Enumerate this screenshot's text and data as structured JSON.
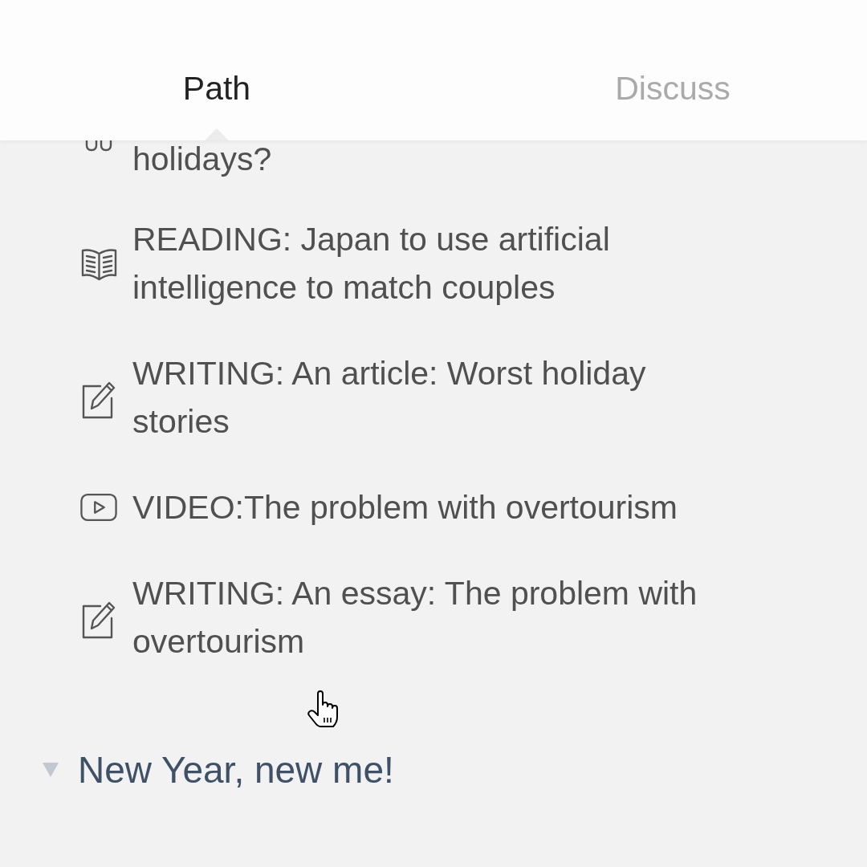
{
  "tabs": [
    {
      "label": "Path",
      "selected": true
    },
    {
      "label": "Discuss",
      "selected": false
    }
  ],
  "items": [
    {
      "kind": "cut",
      "title": "holidays?"
    },
    {
      "kind": "reading",
      "title": "READING: Japan to use artificial intelligence to match couples"
    },
    {
      "kind": "writing",
      "title": "WRITING: An article: Worst holiday stories"
    },
    {
      "kind": "video",
      "title": "VIDEO:The problem with overtourism"
    },
    {
      "kind": "writing",
      "title": "WRITING: An essay: The problem with overtourism"
    }
  ],
  "section": {
    "title": "New Year, new me!",
    "expanded": true
  }
}
